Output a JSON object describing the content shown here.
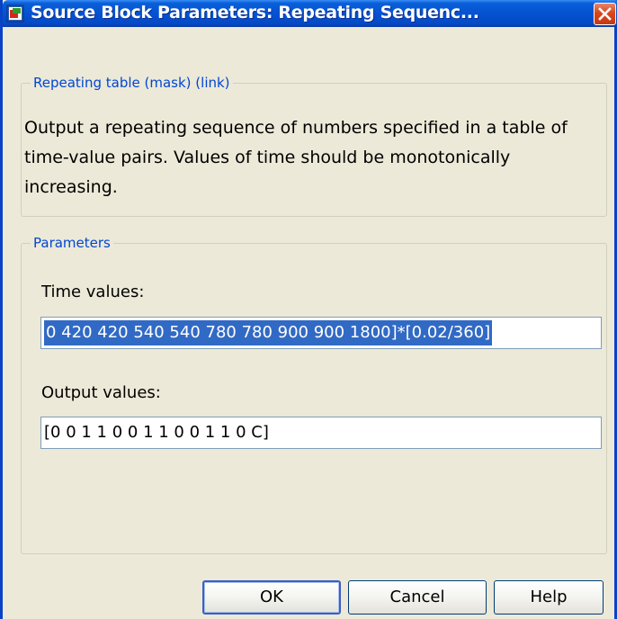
{
  "window": {
    "title": "Source Block Parameters: Repeating Sequenc..."
  },
  "mask_group": {
    "legend": "Repeating table (mask) (link)",
    "description": "Output a repeating sequence of numbers specified in a table of time-value pairs. Values of time should be monotonically increasing."
  },
  "parameters_group": {
    "legend": "Parameters",
    "time_label": "Time values:",
    "time_value": "0 420 420 540 540 780 780 900 900 1800]*[0.02/360]",
    "output_label": "Output values:",
    "output_value": "[0 0 1 1 0 0 1 1 0 0 1 1 0 C]"
  },
  "buttons": {
    "ok": "OK",
    "cancel": "Cancel",
    "help": "Help"
  },
  "colors": {
    "title_bar": "#0552d2",
    "legend_text": "#0046d5",
    "selection": "#316ac5",
    "window_bg": "#ece9d8"
  }
}
